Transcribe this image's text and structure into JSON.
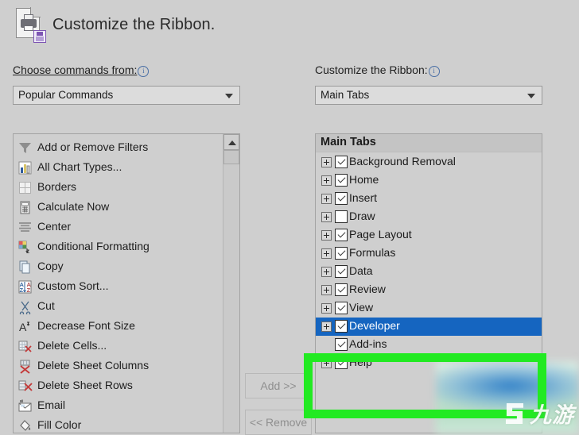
{
  "header": {
    "title": "Customize the Ribbon.",
    "icon": "printer-save-icon"
  },
  "left_panel": {
    "label": "Choose commands from:",
    "info_icon": "i",
    "combo_value": "Popular Commands",
    "commands": [
      {
        "label": "Add or Remove Filters",
        "icon": "filter-icon",
        "submenu": false
      },
      {
        "label": "All Chart Types...",
        "icon": "chart-icon",
        "submenu": false
      },
      {
        "label": "Borders",
        "icon": "borders-icon",
        "submenu": true
      },
      {
        "label": "Calculate Now",
        "icon": "calculator-icon",
        "submenu": false
      },
      {
        "label": "Center",
        "icon": "align-center-icon",
        "submenu": false
      },
      {
        "label": "Conditional Formatting",
        "icon": "cond-format-icon",
        "submenu": true
      },
      {
        "label": "Copy",
        "icon": "copy-icon",
        "submenu": false
      },
      {
        "label": "Custom Sort...",
        "icon": "custom-sort-icon",
        "submenu": false
      },
      {
        "label": "Cut",
        "icon": "scissors-icon",
        "submenu": false
      },
      {
        "label": "Decrease Font Size",
        "icon": "decrease-font-icon",
        "submenu": false
      },
      {
        "label": "Delete Cells...",
        "icon": "delete-cells-icon",
        "submenu": false
      },
      {
        "label": "Delete Sheet Columns",
        "icon": "delete-columns-icon",
        "submenu": false
      },
      {
        "label": "Delete Sheet Rows",
        "icon": "delete-rows-icon",
        "submenu": false
      },
      {
        "label": "Email",
        "icon": "email-icon",
        "submenu": false
      },
      {
        "label": "Fill Color",
        "icon": "fill-color-icon",
        "submenu": true
      }
    ]
  },
  "middle_buttons": {
    "add_label": "Add >>",
    "remove_label": "<< Remove"
  },
  "right_panel": {
    "label": "Customize the Ribbon:",
    "info_icon": "i",
    "combo_value": "Main Tabs",
    "tree_header": "Main Tabs",
    "tabs": [
      {
        "label": "Background Removal",
        "checked": true,
        "selected": false
      },
      {
        "label": "Home",
        "checked": true,
        "selected": false
      },
      {
        "label": "Insert",
        "checked": true,
        "selected": false
      },
      {
        "label": "Draw",
        "checked": false,
        "selected": false
      },
      {
        "label": "Page Layout",
        "checked": true,
        "selected": false
      },
      {
        "label": "Formulas",
        "checked": true,
        "selected": false
      },
      {
        "label": "Data",
        "checked": true,
        "selected": false
      },
      {
        "label": "Review",
        "checked": true,
        "selected": false
      },
      {
        "label": "View",
        "checked": true,
        "selected": false
      },
      {
        "label": "Developer",
        "checked": true,
        "selected": true
      },
      {
        "label": "Add-ins",
        "checked": true,
        "selected": false
      },
      {
        "label": "Help",
        "checked": true,
        "selected": false
      }
    ]
  },
  "annotation": {
    "highlight_color": "#22ea22",
    "selection_color": "#1565c0"
  },
  "watermark": {
    "text": "九游",
    "mark": "g-logo-icon"
  }
}
